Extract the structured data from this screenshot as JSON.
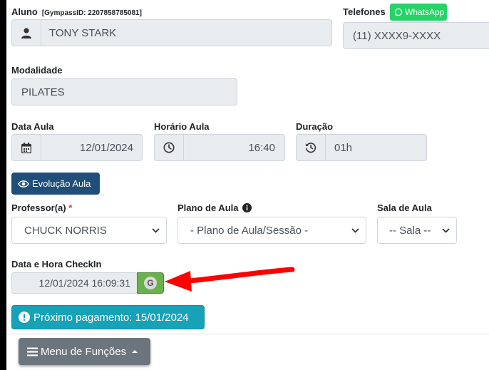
{
  "student": {
    "label": "Aluno",
    "gympass_id": "[GympassID: 2207858785081]",
    "name": "TONY STARK"
  },
  "phones": {
    "label": "Telefones",
    "whatsapp_label": "WhatsApp",
    "value": "(11) XXXX9-XXXX"
  },
  "modality": {
    "label": "Modalidade",
    "value": "PILATES"
  },
  "class_date": {
    "label": "Data Aula",
    "value": "12/01/2024"
  },
  "class_time": {
    "label": "Horário Aula",
    "value": "16:40"
  },
  "duration": {
    "label": "Duração",
    "value": "01h"
  },
  "evolution_button": {
    "label": "Evolução Aula"
  },
  "professor": {
    "label": "Professor(a)",
    "required_mark": "*",
    "selected": "CHUCK NORRIS"
  },
  "lesson_plan": {
    "label": "Plano de Aula",
    "selected": "- Plano de Aula/Sessão -"
  },
  "room": {
    "label": "Sala de Aula",
    "selected": "-- Sala --"
  },
  "checkin": {
    "label": "Data e Hora CheckIn",
    "value": "12/01/2024 16:09:31",
    "badge": "G"
  },
  "next_payment": {
    "label": "Próximo pagamento: 15/01/2024"
  },
  "functions_menu": {
    "label": "Menu de Funções"
  },
  "colors": {
    "whatsapp": "#25d366",
    "primary_dark": "#1f4e79",
    "info": "#17a2b8",
    "secondary": "#6c757d",
    "gympass_badge": "#6ab04c",
    "required": "#dc3545",
    "arrow": "#ff0000"
  }
}
